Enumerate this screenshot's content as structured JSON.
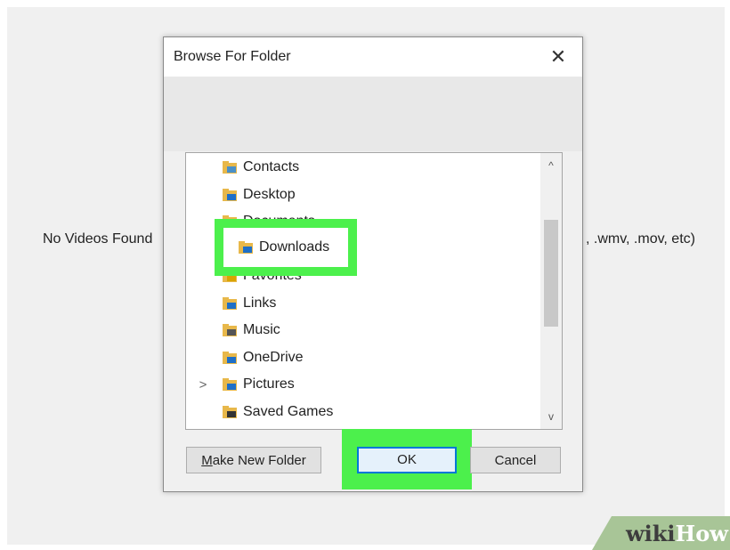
{
  "background": {
    "left_text": "No Videos Found",
    "right_text": ", .wmv, .mov, etc)"
  },
  "dialog": {
    "title": "Browse For Folder",
    "close_glyph": "✕",
    "tree": {
      "items": [
        {
          "label": "Contacts",
          "icon": "contacts-folder-icon",
          "expander": ""
        },
        {
          "label": "Desktop",
          "icon": "desktop-folder-icon",
          "expander": ""
        },
        {
          "label": "Documents",
          "icon": "documents-folder-icon",
          "expander": ""
        },
        {
          "label": "Downloads",
          "icon": "downloads-folder-icon",
          "expander": ""
        },
        {
          "label": "Favorites",
          "icon": "favorites-folder-icon",
          "expander": ""
        },
        {
          "label": "Links",
          "icon": "links-folder-icon",
          "expander": ""
        },
        {
          "label": "Music",
          "icon": "music-folder-icon",
          "expander": ""
        },
        {
          "label": "OneDrive",
          "icon": "onedrive-folder-icon",
          "expander": ""
        },
        {
          "label": "Pictures",
          "icon": "pictures-folder-icon",
          "expander": ">"
        },
        {
          "label": "Saved Games",
          "icon": "saved-games-folder-icon",
          "expander": ""
        }
      ],
      "scroll_up_glyph": "^",
      "scroll_down_glyph": "v"
    },
    "buttons": {
      "make_new_folder_mnemonic": "M",
      "make_new_folder_rest": "ake New Folder",
      "ok": "OK",
      "cancel": "Cancel"
    }
  },
  "watermark": {
    "wiki": "wiki",
    "how": "How"
  },
  "colors": {
    "highlight": "#4cf04c",
    "folder": "#e8b84a",
    "accent": "#0078d7"
  }
}
